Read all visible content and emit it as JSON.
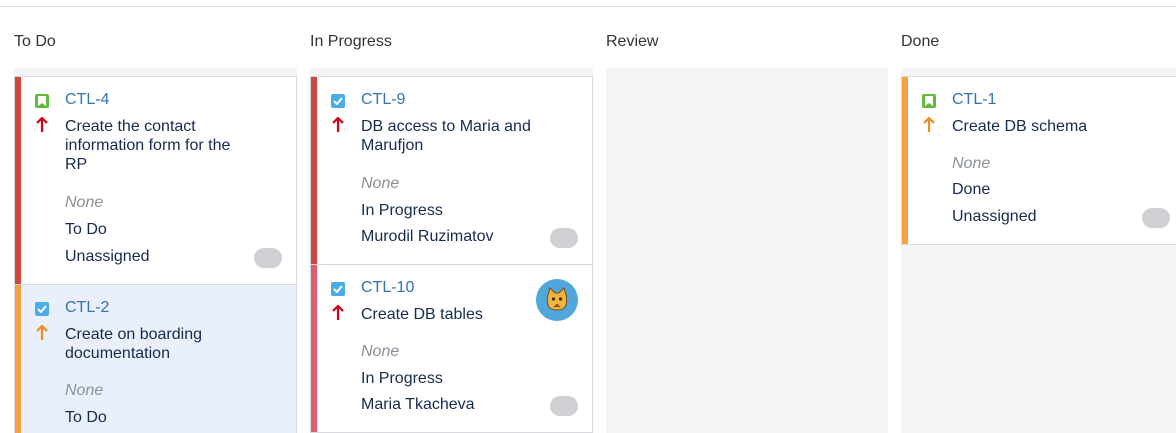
{
  "columns": [
    {
      "title": "To Do"
    },
    {
      "title": "In Progress"
    },
    {
      "title": "Review"
    },
    {
      "title": "Done"
    }
  ],
  "colors": {
    "red_stripe": "#d0473b",
    "orange_stripe": "#f5a042",
    "pink_stripe": "#e25a6e",
    "priority_high": "#d0021b",
    "priority_medium": "#f08c1e",
    "link": "#3572b0"
  },
  "cards": {
    "ctl4": {
      "key": "CTL-4",
      "type_icon": "story-bookmark-icon",
      "priority_icon": "priority-high-arrow-icon",
      "summary": "Create the contact information form for the RP",
      "field_none": "None",
      "status": "To Do",
      "assignee": "Unassigned"
    },
    "ctl2": {
      "key": "CTL-2",
      "type_icon": "task-checkbox-icon",
      "priority_icon": "priority-medium-arrow-icon",
      "summary": "Create on boarding documentation",
      "field_none": "None",
      "status": "To Do"
    },
    "ctl9": {
      "key": "CTL-9",
      "type_icon": "task-checkbox-icon",
      "priority_icon": "priority-high-arrow-icon",
      "summary": "DB access to Maria and Marufjon",
      "field_none": "None",
      "status": "In Progress",
      "assignee": "Murodil Ruzimatov"
    },
    "ctl10": {
      "key": "CTL-10",
      "type_icon": "task-checkbox-icon",
      "priority_icon": "priority-high-arrow-icon",
      "summary": "Create DB tables",
      "field_none": "None",
      "status": "In Progress",
      "assignee": "Maria Tkacheva",
      "avatar": "cat-avatar-icon"
    },
    "ctl1": {
      "key": "CTL-1",
      "type_icon": "story-bookmark-icon",
      "priority_icon": "priority-medium-arrow-icon",
      "summary": "Create DB schema",
      "field_none": "None",
      "status": "Done",
      "assignee": "Unassigned"
    }
  }
}
